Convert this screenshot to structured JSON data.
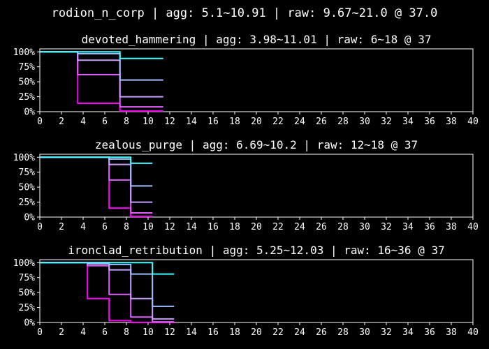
{
  "title": "rodion_n_corp | agg: 5.1~10.91 | raw: 9.67~21.0 @ 37.0",
  "colors": {
    "background": "#000000",
    "axis": "#ffffff",
    "text": "#ffffff",
    "series": [
      "#ff00ff",
      "#e060ff",
      "#c8a0ff",
      "#a0c0ff",
      "#40ffff"
    ]
  },
  "chart_data": [
    {
      "type": "line",
      "step": "post",
      "title": "devoted_hammering | agg: 3.98~11.01 | raw: 6~18 @ 37",
      "xlim": [
        0,
        40
      ],
      "ylim": [
        0,
        1.05
      ],
      "xticks": [
        0,
        2,
        4,
        6,
        8,
        10,
        12,
        14,
        16,
        18,
        20,
        22,
        24,
        26,
        28,
        30,
        32,
        34,
        36,
        38,
        40
      ],
      "yticks": [
        0,
        0.25,
        0.5,
        0.75,
        1.0
      ],
      "ytick_labels": [
        "0%",
        "25%",
        "50%",
        "75%",
        "100%"
      ],
      "series": [
        {
          "x": [
            0,
            3.5,
            7.4,
            11.4
          ],
          "y": [
            1.0,
            0.14,
            0.01,
            0.01
          ]
        },
        {
          "x": [
            0,
            3.5,
            7.4,
            11.4
          ],
          "y": [
            1.0,
            0.62,
            0.08,
            0.08
          ]
        },
        {
          "x": [
            0,
            3.5,
            7.4,
            11.4
          ],
          "y": [
            1.0,
            0.86,
            0.25,
            0.25
          ]
        },
        {
          "x": [
            0,
            3.5,
            7.4,
            11.4
          ],
          "y": [
            1.0,
            0.97,
            0.53,
            0.53
          ]
        },
        {
          "x": [
            0,
            3.5,
            7.4,
            11.4
          ],
          "y": [
            1.0,
            1.0,
            0.89,
            0.89
          ]
        }
      ]
    },
    {
      "type": "line",
      "step": "post",
      "title": "zealous_purge | agg: 6.69~10.2 | raw: 12~18 @ 37",
      "xlim": [
        0,
        40
      ],
      "ylim": [
        0,
        1.05
      ],
      "xticks": [
        0,
        2,
        4,
        6,
        8,
        10,
        12,
        14,
        16,
        18,
        20,
        22,
        24,
        26,
        28,
        30,
        32,
        34,
        36,
        38,
        40
      ],
      "yticks": [
        0,
        0.25,
        0.5,
        0.75,
        1.0
      ],
      "ytick_labels": [
        "0%",
        "25%",
        "50%",
        "75%",
        "100%"
      ],
      "series": [
        {
          "x": [
            0,
            6.4,
            8.4,
            10.4
          ],
          "y": [
            1.0,
            0.15,
            0.01,
            0.01
          ]
        },
        {
          "x": [
            0,
            6.4,
            8.4,
            10.4
          ],
          "y": [
            1.0,
            0.62,
            0.07,
            0.07
          ]
        },
        {
          "x": [
            0,
            6.4,
            8.4,
            10.4
          ],
          "y": [
            1.0,
            0.88,
            0.25,
            0.25
          ]
        },
        {
          "x": [
            0,
            6.4,
            8.4,
            10.4
          ],
          "y": [
            1.0,
            0.97,
            0.52,
            0.52
          ]
        },
        {
          "x": [
            0,
            6.4,
            8.4,
            10.4
          ],
          "y": [
            1.0,
            1.0,
            0.9,
            0.9
          ]
        }
      ]
    },
    {
      "type": "line",
      "step": "post",
      "title": "ironclad_retribution | agg: 5.25~12.03 | raw: 16~36 @ 37",
      "xlim": [
        0,
        40
      ],
      "ylim": [
        0,
        1.05
      ],
      "xticks": [
        0,
        2,
        4,
        6,
        8,
        10,
        12,
        14,
        16,
        18,
        20,
        22,
        24,
        26,
        28,
        30,
        32,
        34,
        36,
        38,
        40
      ],
      "yticks": [
        0,
        0.25,
        0.5,
        0.75,
        1.0
      ],
      "ytick_labels": [
        "0%",
        "25%",
        "50%",
        "75%",
        "100%"
      ],
      "series": [
        {
          "x": [
            0,
            4.4,
            6.4,
            8.4,
            10.4,
            12.4
          ],
          "y": [
            1.0,
            0.4,
            0.03,
            0.0,
            0.0,
            0.0
          ]
        },
        {
          "x": [
            0,
            4.4,
            6.4,
            8.4,
            10.4,
            12.4
          ],
          "y": [
            1.0,
            0.95,
            0.47,
            0.09,
            0.01,
            0.01
          ]
        },
        {
          "x": [
            0,
            4.4,
            6.4,
            8.4,
            10.4,
            12.4
          ],
          "y": [
            1.0,
            0.98,
            0.88,
            0.4,
            0.06,
            0.06
          ]
        },
        {
          "x": [
            0,
            4.4,
            6.4,
            8.4,
            10.4,
            12.4
          ],
          "y": [
            1.0,
            1.0,
            0.97,
            0.81,
            0.27,
            0.27
          ]
        },
        {
          "x": [
            0,
            4.4,
            6.4,
            8.4,
            10.4,
            12.4
          ],
          "y": [
            1.0,
            1.0,
            1.0,
            1.0,
            0.81,
            0.81
          ]
        }
      ]
    }
  ]
}
